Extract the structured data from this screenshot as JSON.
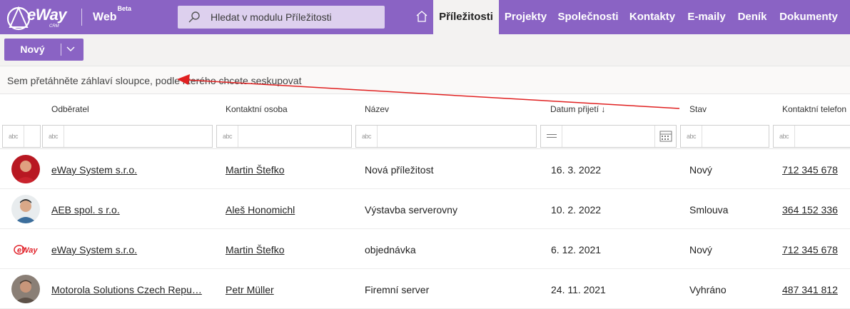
{
  "app": {
    "logo_text": "eWay",
    "logo_sub": "CRM",
    "web_label": "Web",
    "beta_label": "Beta"
  },
  "search": {
    "placeholder": "Hledat v modulu Příležitosti"
  },
  "nav": {
    "items": [
      {
        "label": "Příležitosti",
        "active": true
      },
      {
        "label": "Projekty"
      },
      {
        "label": "Společnosti"
      },
      {
        "label": "Kontakty"
      },
      {
        "label": "E-maily"
      },
      {
        "label": "Deník"
      },
      {
        "label": "Dokumenty"
      }
    ]
  },
  "toolbar": {
    "new_label": "Nový"
  },
  "grouping": {
    "hint": "Sem přetáhněte záhlaví sloupce, podle kterého chcete seskupovat"
  },
  "table": {
    "columns": [
      "Odběratel",
      "Kontaktní osoba",
      "Název",
      "Datum přijetí",
      "Stav",
      "Kontaktní telefon"
    ],
    "sort_indicator": "↓",
    "filter_abc": "abc",
    "rows": [
      {
        "company": "eWay System s.r.o.",
        "contact": "Martin Štefko",
        "name": "Nová příležitost",
        "date": "16. 3. 2022",
        "status": "Nový",
        "phone": "712 345 678"
      },
      {
        "company": "AEB spol. s r.o.",
        "contact": "Aleš Honomichl",
        "name": "Výstavba serverovny",
        "date": "10. 2. 2022",
        "status": "Smlouva",
        "phone": "364 152 336"
      },
      {
        "company": "eWay System s.r.o.",
        "contact": "Martin Štefko",
        "name": "objednávka",
        "date": "6. 12. 2021",
        "status": "Nový",
        "phone": "712 345 678",
        "avatar_logo": "eWay"
      },
      {
        "company": "Motorola Solutions Czech Repu…",
        "contact": "Petr Müller",
        "name": "Firemní server",
        "date": "24. 11. 2021",
        "status": "Vyhráno",
        "phone": "487 341 812"
      }
    ]
  },
  "colors": {
    "brand": "#8a63c4",
    "annotation": "#e02020"
  }
}
